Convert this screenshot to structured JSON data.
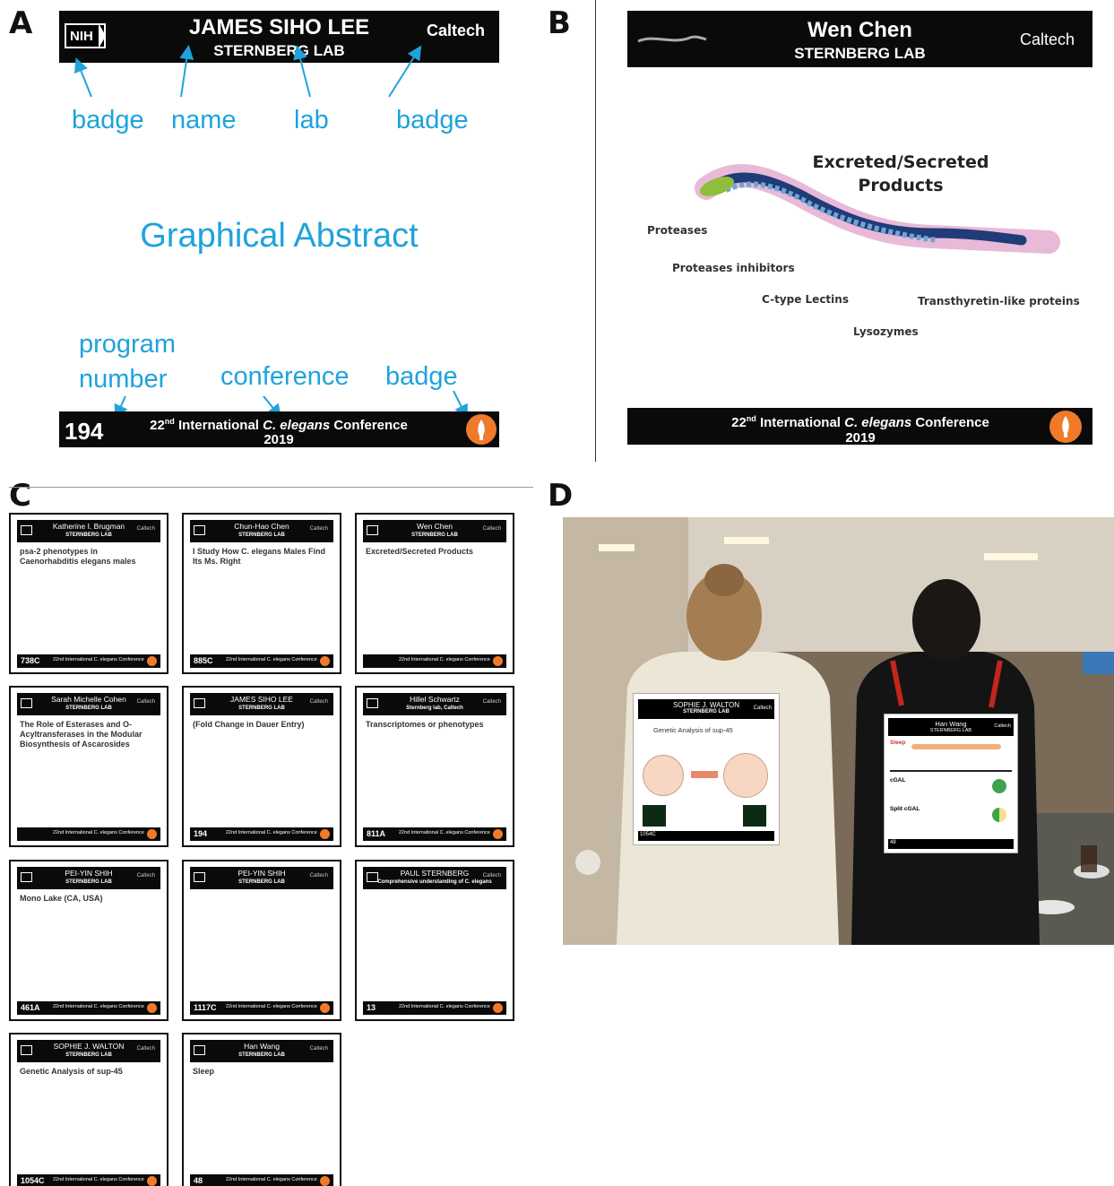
{
  "panels": {
    "a": "A",
    "b": "B",
    "c": "C",
    "d": "D"
  },
  "panelA": {
    "badge_left": "NIH",
    "name": "JAMES SIHO LEE",
    "lab": "STERNBERG LAB",
    "badge_right": "Caltech",
    "label_badge_1": "badge",
    "label_name": "name",
    "label_lab": "lab",
    "label_badge_2": "badge",
    "center_label": "Graphical Abstract",
    "label_program": "program",
    "label_number": "number",
    "label_conference": "conference",
    "label_badge_3": "badge",
    "footer_number": "194",
    "conf_line_pre": "22",
    "conf_sup": "nd",
    "conf_line_mid": " International ",
    "conf_italic": "C. elegans",
    "conf_line_post": " Conference",
    "conf_year": "2019"
  },
  "panelB": {
    "name": "Wen Chen",
    "lab": "STERNBERG LAB",
    "badge_right": "Caltech",
    "title_line1": "Excreted/Secreted",
    "title_line2": "Products",
    "proteases": "Proteases",
    "inhibitors": "Proteases inhibitors",
    "lectins": "C-type Lectins",
    "transthyretin": "Transthyretin-like proteins",
    "lysozymes": "Lysozymes",
    "conf_pre": "22",
    "conf_sup": "nd",
    "conf_mid": " International ",
    "conf_italic": "C. elegans",
    "conf_post": " Conference",
    "conf_year": "2019"
  },
  "thumbs": [
    {
      "name": "Katherine I. Brugman",
      "lab": "STERNBERG LAB",
      "number": "738C",
      "body": "psa-2 phenotypes in Caenorhabditis elegans males"
    },
    {
      "name": "Chun-Hao Chen",
      "lab": "STERNBERG LAB",
      "number": "885C",
      "body": "I Study How C. elegans Males Find Its Ms. Right"
    },
    {
      "name": "Wen Chen",
      "lab": "STERNBERG LAB",
      "number": "",
      "body": "Excreted/Secreted Products"
    },
    {
      "name": "Sarah Michelle Cohen",
      "lab": "STERNBERG LAB",
      "number": "",
      "body": "The Role of Esterases and O-Acyltransferases in the Modular Biosynthesis of Ascarosides"
    },
    {
      "name": "JAMES SIHO LEE",
      "lab": "STERNBERG LAB",
      "number": "194",
      "body": "(Fold Change in Dauer Entry)"
    },
    {
      "name": "Hillel Schwartz",
      "lab": "Sternberg lab, Caltech",
      "number": "811A",
      "body": "Transcriptomes or phenotypes"
    },
    {
      "name": "PEI-YIN SHIH",
      "lab": "STERNBERG LAB",
      "number": "461A",
      "body": "Mono Lake (CA, USA)"
    },
    {
      "name": "PEI-YIN SHIH",
      "lab": "STERNBERG LAB",
      "number": "1117C",
      "body": ""
    },
    {
      "name": "PAUL STERNBERG",
      "lab": "Comprehensive understanding of C. elegans",
      "number": "13",
      "body": ""
    },
    {
      "name": "SOPHIE J. WALTON",
      "lab": "STERNBERG LAB",
      "number": "1054C",
      "body": "Genetic Analysis of sup-45"
    },
    {
      "name": "Han Wang",
      "lab": "STERNBERG LAB",
      "number": "48",
      "body": "Sleep"
    }
  ],
  "thumb_badge": "Caltech",
  "thumb_conf": "22nd International C. elegans Conference",
  "panelD": {
    "left_name": "SOPHIE J. WALTON",
    "left_lab": "STERNBERG LAB",
    "left_badge": "Caltech",
    "left_title": "Genetic Analysis of sup-45",
    "left_number": "1054C",
    "right_name": "Han Wang",
    "right_lab": "STERNBERG LAB",
    "right_badge": "Caltech",
    "right_sleep": "Sleep",
    "right_cgal": "cGAL",
    "right_split": "Split cGAL",
    "right_number": "48"
  }
}
